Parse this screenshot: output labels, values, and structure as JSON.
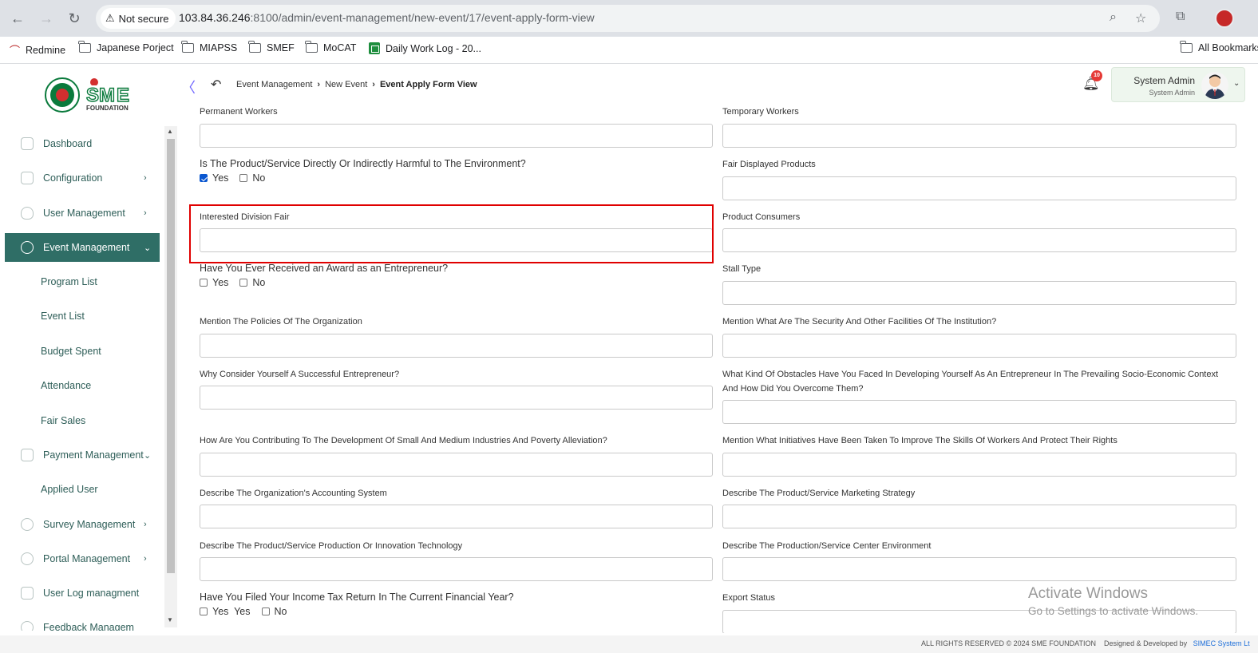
{
  "browser": {
    "security": "Not secure",
    "url_host": "103.84.36.246",
    "url_rest": ":8100/admin/event-management/new-event/17/event-apply-form-view",
    "bookmarks": [
      "Redmine",
      "Japanese Porject",
      "MIAPSS",
      "SMEF",
      "MoCAT",
      "Daily Work Log - 20...",
      "All Bookmarks"
    ]
  },
  "header": {
    "logo_text": "SME",
    "logo_sub": "FOUNDATION",
    "breadcrumb": [
      "Event Management",
      "New Event",
      "Event Apply Form View"
    ],
    "notification_count": "10",
    "user_name": "System Admin",
    "user_role": "System Admin"
  },
  "sidebar": {
    "items": [
      {
        "label": "Dashboard"
      },
      {
        "label": "Configuration"
      },
      {
        "label": "User Management"
      },
      {
        "label": "Event Management"
      },
      {
        "label": "Payment Management"
      },
      {
        "label": "Survey Management"
      },
      {
        "label": "Portal Management"
      },
      {
        "label": "User Log managment"
      },
      {
        "label": "Feedback Managem"
      }
    ],
    "event_sub": [
      "Program List",
      "Event List",
      "Budget Spent",
      "Attendance",
      "Fair Sales"
    ],
    "payment_sub": [
      "Applied User"
    ]
  },
  "form": {
    "left": {
      "permanent_workers": "Permanent Workers",
      "harmful_q": "Is The Product/Service Directly Or Indirectly Harmful to The Environment?",
      "interested_division": "Interested Division Fair",
      "award_q": "Have You Ever Received an Award as an Entrepreneur?",
      "policies": "Mention The Policies Of The Organization",
      "successful": "Why Consider Yourself A Successful Entrepreneur?",
      "contributing": "How Are You Contributing To The Development Of Small And Medium Industries And Poverty Alleviation?",
      "accounting": "Describe The Organization's Accounting System",
      "technology": "Describe The Product/Service Production Or Innovation Technology",
      "tax_q": "Have You Filed Your Income Tax Return In The Current Financial Year?"
    },
    "right": {
      "temporary_workers": "Temporary Workers",
      "fair_displayed": "Fair Displayed Products",
      "consumers": "Product Consumers",
      "stall_type": "Stall Type",
      "security": "Mention What Are The Security And Other Facilities Of The Institution?",
      "obstacles_1": "What Kind Of Obstacles Have You Faced In Developing Yourself As An Entrepreneur In The Prevailing Socio-Economic Context",
      "obstacles_2": "And How Did You Overcome Them?",
      "initiatives": "Mention What Initiatives Have Been Taken To Improve The Skills Of Workers And Protect Their Rights",
      "marketing": "Describe The Product/Service Marketing Strategy",
      "environment": "Describe The Production/Service Center Environment",
      "export": "Export Status"
    },
    "yes": "Yes",
    "no": "No",
    "yes_yes": "Yes  Yes"
  },
  "watermark": {
    "line1": "Activate Windows",
    "line2": "Go to Settings to activate Windows."
  },
  "footer": {
    "rights": "ALL RIGHTS RESERVED © 2024 SME FOUNDATION",
    "designed": "Designed & Developed by",
    "company": "SIMEC System Lt"
  }
}
